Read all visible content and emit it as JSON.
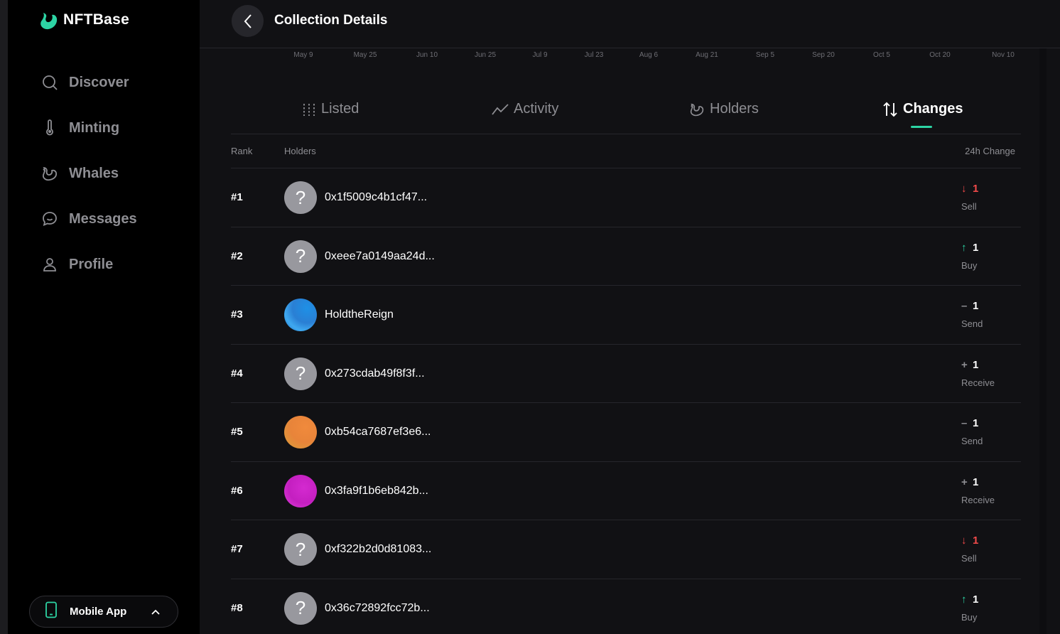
{
  "brand": {
    "name": "NFTBase",
    "accent": "#2dd4a4"
  },
  "sidebar": {
    "items": [
      {
        "label": "Discover",
        "icon": "search-icon"
      },
      {
        "label": "Minting",
        "icon": "thermometer-icon"
      },
      {
        "label": "Whales",
        "icon": "whale-icon"
      },
      {
        "label": "Messages",
        "icon": "chat-icon"
      },
      {
        "label": "Profile",
        "icon": "user-icon"
      }
    ],
    "mobile_app": {
      "label": "Mobile App"
    }
  },
  "header": {
    "title": "Collection Details"
  },
  "chart_axis": {
    "labels": [
      "May 9",
      "May 25",
      "Jun 10",
      "Jun 25",
      "Jul 9",
      "Jul 23",
      "Aug 6",
      "Aug 21",
      "Sep 5",
      "Sep 20",
      "Oct 5",
      "Oct 20",
      "Nov 10"
    ]
  },
  "tabs": [
    {
      "label": "Listed",
      "icon": "bars-icon",
      "active": false
    },
    {
      "label": "Activity",
      "icon": "trend-icon",
      "active": false
    },
    {
      "label": "Holders",
      "icon": "whale-icon",
      "active": false
    },
    {
      "label": "Changes",
      "icon": "sort-arrows-icon",
      "active": true
    }
  ],
  "table": {
    "columns": {
      "rank": "Rank",
      "holders": "Holders",
      "change": "24h Change"
    },
    "rows": [
      {
        "rank": "#1",
        "name": "0x1f5009c4b1cf47...",
        "avatar": "unknown",
        "sign": "↓",
        "sign_color": "#f24a4a",
        "value": "1",
        "value_color": "#f24a4a",
        "type": "Sell"
      },
      {
        "rank": "#2",
        "name": "0xeee7a0149aa24d...",
        "avatar": "unknown",
        "sign": "↑",
        "sign_color": "#2dd4a4",
        "value": "1",
        "value_color": "#ffffff",
        "type": "Buy"
      },
      {
        "rank": "#3",
        "name": "HoldtheReign",
        "avatar": "blue",
        "sign": "–",
        "sign_color": "#8e8e93",
        "value": "1",
        "value_color": "#ffffff",
        "type": "Send"
      },
      {
        "rank": "#4",
        "name": "0x273cdab49f8f3f...",
        "avatar": "unknown",
        "sign": "+",
        "sign_color": "#8e8e93",
        "value": "1",
        "value_color": "#ffffff",
        "type": "Receive"
      },
      {
        "rank": "#5",
        "name": "0xb54ca7687ef3e6...",
        "avatar": "orange",
        "sign": "–",
        "sign_color": "#8e8e93",
        "value": "1",
        "value_color": "#ffffff",
        "type": "Send"
      },
      {
        "rank": "#6",
        "name": "0x3fa9f1b6eb842b...",
        "avatar": "magenta",
        "sign": "+",
        "sign_color": "#8e8e93",
        "value": "1",
        "value_color": "#ffffff",
        "type": "Receive"
      },
      {
        "rank": "#7",
        "name": "0xf322b2d0d81083...",
        "avatar": "unknown",
        "sign": "↓",
        "sign_color": "#f24a4a",
        "value": "1",
        "value_color": "#f24a4a",
        "type": "Sell"
      },
      {
        "rank": "#8",
        "name": "0x36c72892fcc72b...",
        "avatar": "unknown",
        "sign": "↑",
        "sign_color": "#2dd4a4",
        "value": "1",
        "value_color": "#ffffff",
        "type": "Buy"
      }
    ]
  }
}
